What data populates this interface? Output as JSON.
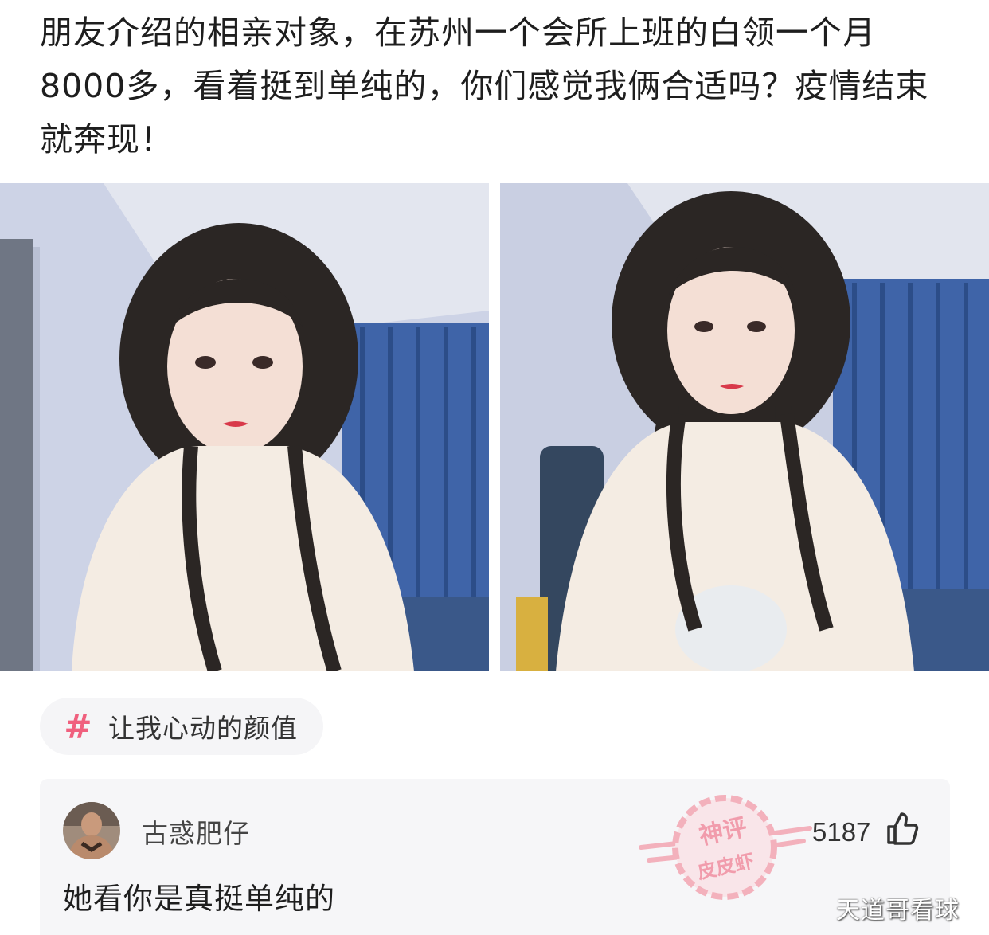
{
  "post": {
    "text": "朋友介绍的相亲对象，在苏州一个会所上班的白领一个月8000多，看着挺到单纯的，你们感觉我俩合适吗？疫情结束就奔现！"
  },
  "photos": [
    {
      "scene": "selfie-girl-braids-blue-curtain"
    },
    {
      "scene": "selfie-girl-braids-blue-curtain-ac-unit"
    }
  ],
  "topic": {
    "icon": "hashtag-icon",
    "label": "让我心动的颜值",
    "accent": "#f0607e"
  },
  "comment": {
    "username": "古惑肥仔",
    "text": "她看你是真挺单纯的",
    "likes": "5187",
    "stamp_top": "神评",
    "stamp_bottom": "皮皮虾",
    "stamp_color": "#f29aa8"
  },
  "watermark": "天道哥看球"
}
